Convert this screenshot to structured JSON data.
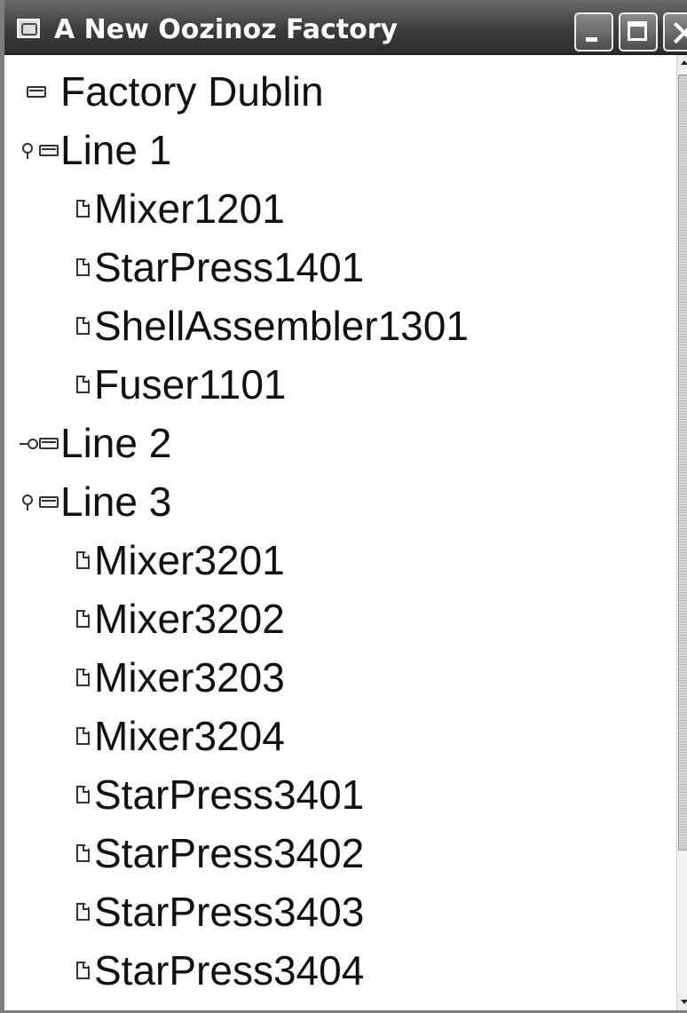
{
  "window": {
    "title": "A New Oozinoz Factory"
  },
  "tree": {
    "root": {
      "label": "Factory Dublin",
      "icon": "folder-icon"
    },
    "lines": [
      {
        "label": "Line 1",
        "state": "expanded",
        "children": [
          "Mixer1201",
          "StarPress1401",
          "ShellAssembler1301",
          "Fuser1101"
        ]
      },
      {
        "label": "Line 2",
        "state": "collapsed",
        "children": []
      },
      {
        "label": "Line 3",
        "state": "expanded",
        "children": [
          "Mixer3201",
          "Mixer3202",
          "Mixer3203",
          "Mixer3204",
          "StarPress3401",
          "StarPress3402",
          "StarPress3403",
          "StarPress3404"
        ]
      }
    ]
  },
  "icons": {
    "window": "app-window-icon",
    "minimize": "minimize-icon",
    "maximize": "maximize-icon",
    "close": "close-icon",
    "handle_expanded": "tree-handle-expanded-icon",
    "handle_collapsed": "tree-handle-collapsed-icon",
    "folder": "folder-icon",
    "leaf": "document-icon"
  },
  "colors": {
    "titlebar": "#3c3c3c",
    "title_text": "#ffffff",
    "tree_background": "#ffffff",
    "tree_text": "#111111"
  }
}
